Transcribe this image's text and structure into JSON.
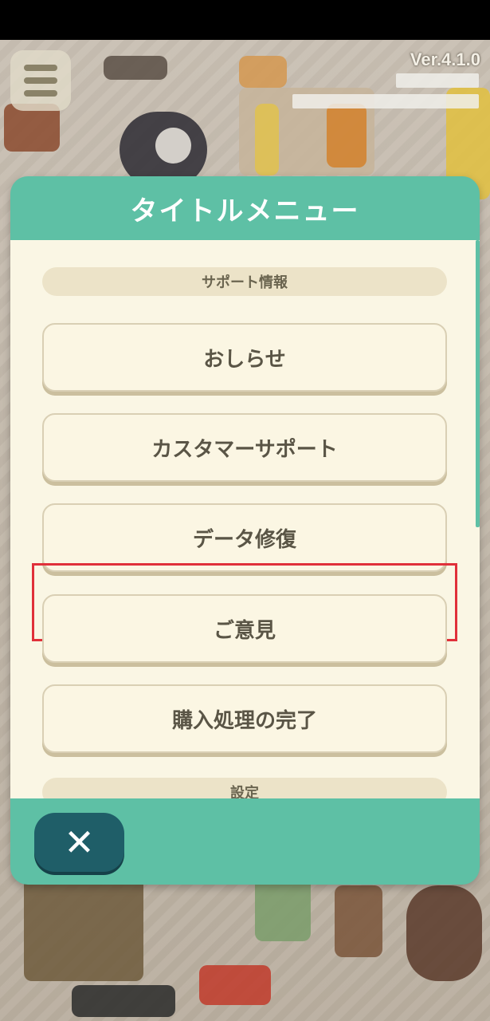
{
  "app": {
    "version": "Ver.4.1.0"
  },
  "dialog": {
    "title": "タイトルメニュー",
    "sections": [
      {
        "label": "サポート情報",
        "items": [
          {
            "label": "おしらせ"
          },
          {
            "label": "カスタマーサポート"
          },
          {
            "label": "データ修復",
            "highlighted": true
          },
          {
            "label": "ご意見"
          },
          {
            "label": "購入処理の完了"
          }
        ]
      },
      {
        "label": "設定",
        "items": []
      }
    ],
    "close_icon": "close-icon",
    "colors": {
      "header": "#5ec0a5",
      "body": "#faf6e4",
      "close_button": "#1f5e68",
      "highlight": "#e0303a"
    }
  }
}
